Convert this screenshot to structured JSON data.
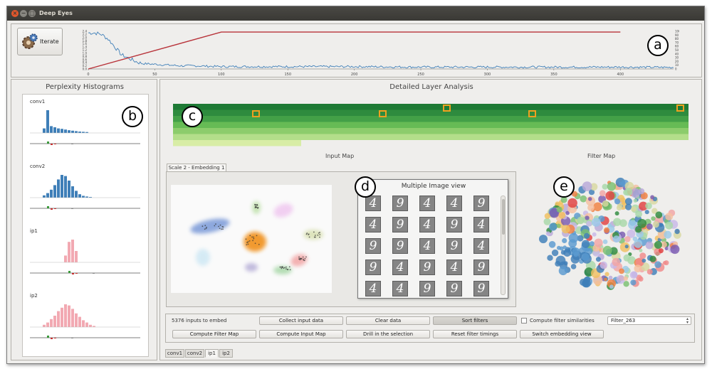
{
  "window": {
    "title": "Deep Eyes"
  },
  "toolbar": {
    "iterate_label": "Iterate"
  },
  "badges": {
    "a": "a",
    "b": "b",
    "c": "c",
    "d": "d",
    "e": "e"
  },
  "top_chart": {
    "x_ticks": [
      "0",
      "50",
      "100",
      "150",
      "200",
      "250",
      "300",
      "350",
      "400"
    ],
    "y_left_ticks": [
      "2.4",
      "2.2",
      "2.0",
      "1.8",
      "1.6",
      "1.4",
      "1.2",
      "1.0",
      "0.8",
      "0.6",
      "0.4",
      "0.2",
      "0.0"
    ],
    "y_right_ticks": [
      "100",
      "90",
      "80",
      "70",
      "60",
      "50",
      "40",
      "30",
      "20",
      "10",
      "0"
    ],
    "colors": {
      "loss": "#3f7fb8",
      "accuracy": "#b8333a"
    }
  },
  "chart_data": {
    "type": "line",
    "x_range": [
      0,
      440
    ],
    "y_left_range": [
      0,
      2.4
    ],
    "y_right_range": [
      0,
      100
    ],
    "grid": false,
    "series": [
      {
        "axis": "left",
        "x": [
          0,
          5,
          10,
          15,
          20,
          25,
          30,
          35,
          40,
          50,
          60,
          70,
          80,
          100,
          150,
          200,
          250,
          300,
          350,
          400,
          440
        ],
        "values": [
          2.3,
          2.3,
          2.2,
          1.9,
          1.4,
          0.9,
          0.7,
          0.5,
          0.35,
          0.3,
          0.25,
          0.2,
          0.2,
          0.15,
          0.15,
          0.15,
          0.12,
          0.12,
          0.12,
          0.12,
          0.1
        ]
      },
      {
        "axis": "right",
        "x": [
          0,
          100,
          400
        ],
        "values": [
          0,
          98,
          98
        ]
      }
    ]
  },
  "left_panel": {
    "title": "Perplexity Histograms",
    "layers": [
      {
        "name": "conv1",
        "color": "#3f7fb8",
        "bars": [
          0.2,
          1.0,
          0.3,
          0.25,
          0.2,
          0.18,
          0.15,
          0.12,
          0.1,
          0.08,
          0.06,
          0.05,
          0.04
        ]
      },
      {
        "name": "conv2",
        "color": "#3f7fb8",
        "bars": [
          0.1,
          0.2,
          0.35,
          0.55,
          0.8,
          1.0,
          0.95,
          0.75,
          0.5,
          0.3,
          0.15,
          0.08,
          0.05,
          0.03
        ]
      },
      {
        "name": "ip1",
        "color": "#f2a9b2",
        "bars": [
          0.3,
          0.9,
          1.0,
          0.5
        ]
      },
      {
        "name": "ip2",
        "color": "#f2a9b2",
        "bars": [
          0.1,
          0.2,
          0.35,
          0.5,
          0.7,
          0.85,
          1.0,
          0.95,
          0.8,
          0.6,
          0.45,
          0.3,
          0.2,
          0.1,
          0.05
        ]
      }
    ]
  },
  "right_panel": {
    "title": "Detailed Layer Analysis",
    "input_map_label": "Input Map",
    "filter_map_label": "Filter Map",
    "embedding_tab": "Scale 2 - Embedding 1",
    "multi_view_title": "Multiple Image view",
    "digits": [
      "4",
      "9",
      "4",
      "4",
      "9",
      "4",
      "9",
      "4",
      "9",
      "4",
      "9",
      "9",
      "4",
      "9",
      "4",
      "9",
      "4",
      "9",
      "4",
      "9",
      "4",
      "4",
      "9",
      "9",
      "9"
    ],
    "controls": {
      "inputs_to_embed": "5376 inputs to embed",
      "collect_input_data": "Collect input data",
      "clear_data": "Clear data",
      "sort_filters": "Sort filters",
      "compute_filter_similarities": "Compute filter similarities",
      "filter_select": "Filter_263",
      "compute_filter_map": "Compute Filter Map",
      "compute_input_map": "Compute Input Map",
      "drill_selection": "Drill in the selection",
      "reset_filter_timings": "Reset filter timings",
      "switch_embedding_view": "Switch embedding view"
    },
    "layer_tabs": [
      "conv1",
      "conv2",
      "ip1",
      "ip2"
    ],
    "active_layer_tab": "ip1",
    "heatmap_colors": [
      "#1e7a35",
      "#2e8b3e",
      "#43a047",
      "#66bb55",
      "#8ccc6c",
      "#b3de8a",
      "#d8eda6"
    ],
    "highlight_color": "#f0a020"
  }
}
